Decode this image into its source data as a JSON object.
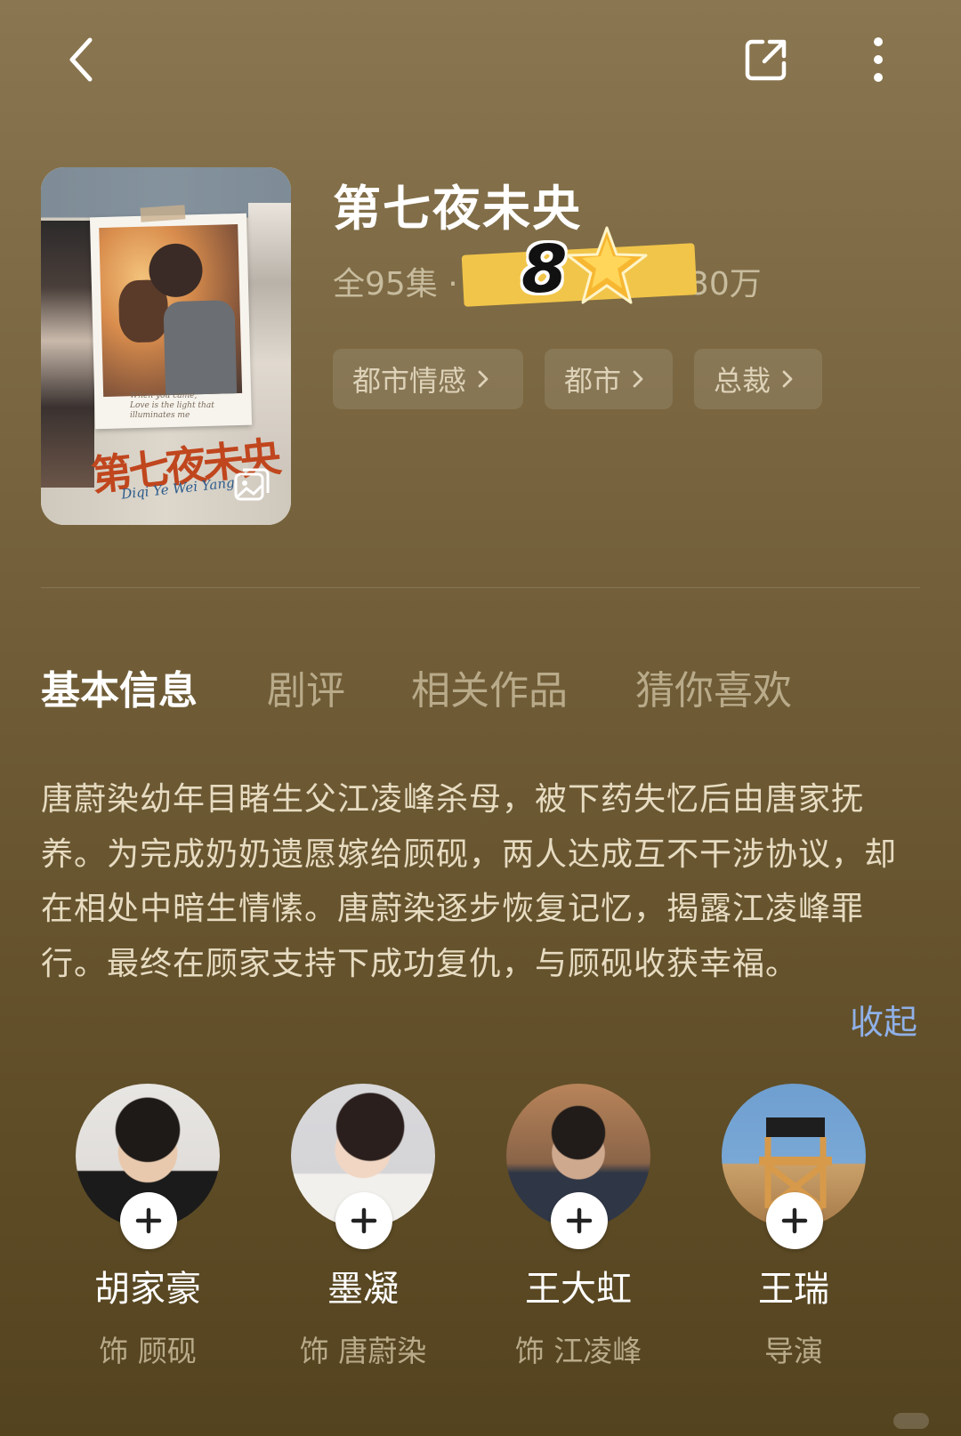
{
  "topbar": {
    "back_icon": "chevron-left-icon",
    "share_icon": "share-external-icon",
    "more_icon": "more-vertical-icon"
  },
  "show": {
    "title": "第七夜未央",
    "episodes": "全95集 ·",
    "popularity": "30万",
    "score": "8",
    "poster": {
      "caption_line1": "When you came,",
      "caption_line2": "Love is the light that illuminates me",
      "title_art": "第七夜未央",
      "title_pinyin": "Diqi Ye Wei Yang"
    }
  },
  "tags": [
    {
      "label": "都市情感"
    },
    {
      "label": "都市"
    },
    {
      "label": "总裁"
    }
  ],
  "tabs": [
    {
      "label": "基本信息",
      "active": true
    },
    {
      "label": "剧评",
      "active": false
    },
    {
      "label": "相关作品",
      "active": false
    },
    {
      "label": "猜你喜欢",
      "active": false
    }
  ],
  "synopsis": {
    "text": "唐蔚染幼年目睹生父江凌峰杀母，被下药失忆后由唐家抚养。为完成奶奶遗愿嫁给顾砚，两人达成互不干涉协议，却在相处中暗生情愫。唐蔚染逐步恢复记忆，揭露江凌峰罪行。最终在顾家支持下成功复仇，与顾砚收获幸福。",
    "collapse_label": "收起"
  },
  "cast": [
    {
      "name": "胡家豪",
      "role": "饰 顾砚"
    },
    {
      "name": "墨凝",
      "role": "饰 唐蔚染"
    },
    {
      "name": "王大虹",
      "role": "饰 江凌峰"
    },
    {
      "name": "王瑞",
      "role": "导演"
    }
  ],
  "colors": {
    "accent_link": "#8fb0e8",
    "score_band": "#f1c54a",
    "bg_top": "#8a7650",
    "bg_bottom": "#54431f"
  }
}
